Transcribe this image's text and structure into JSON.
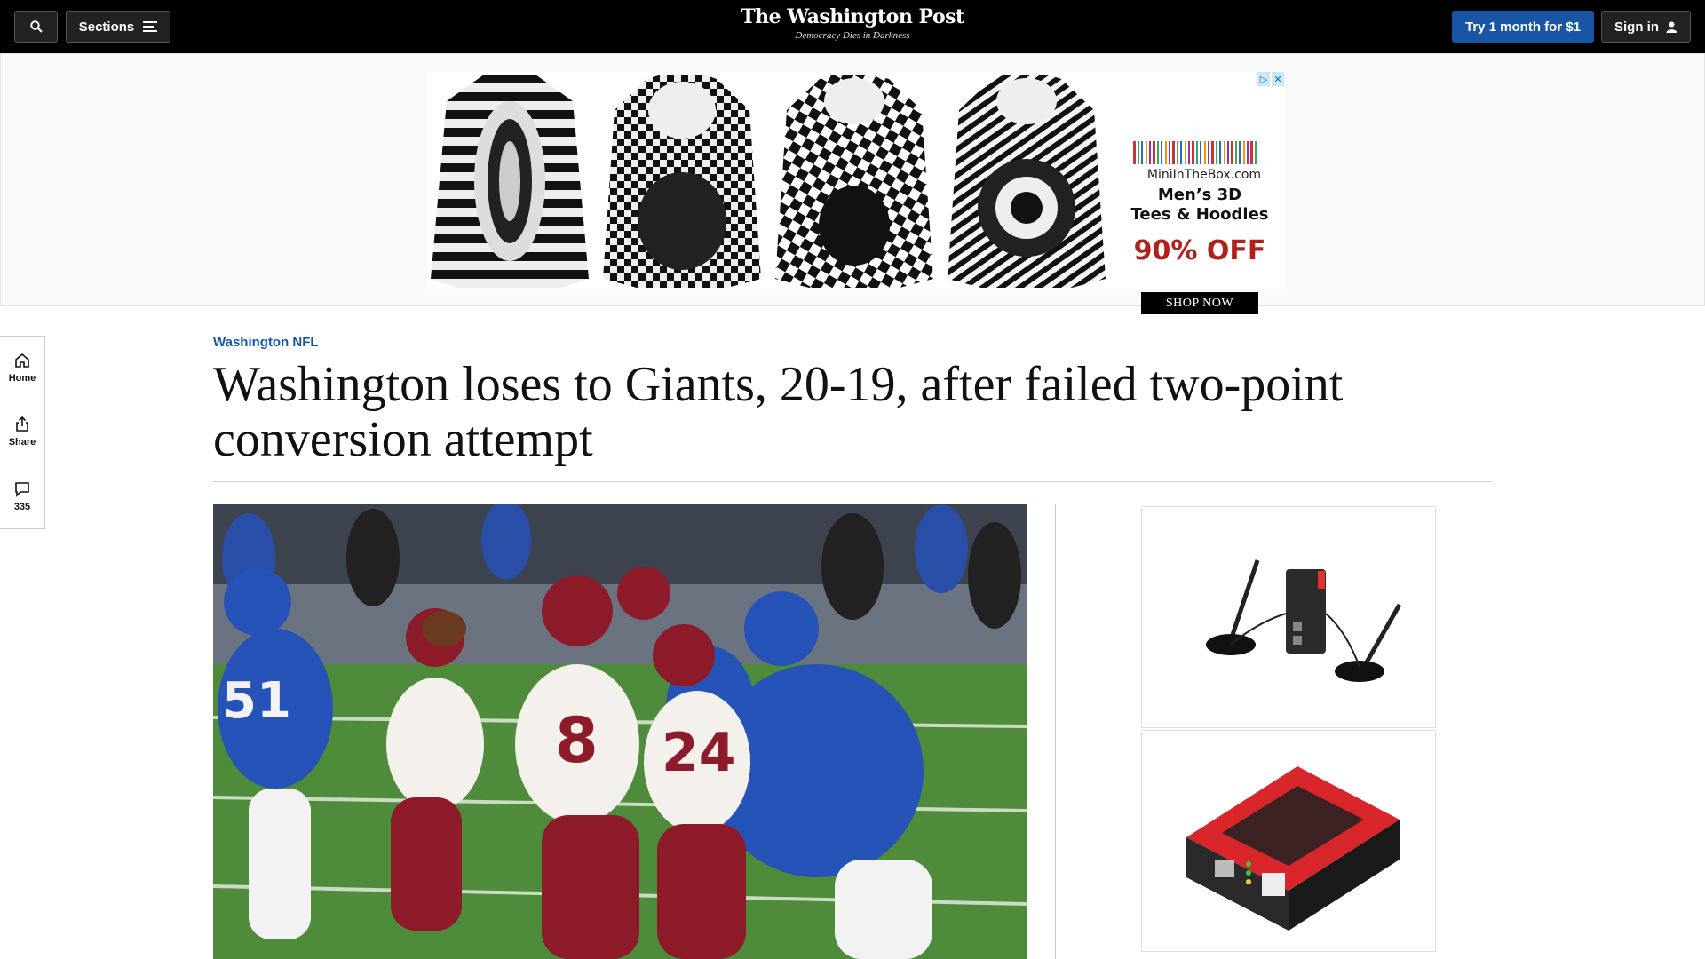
{
  "topbar": {
    "search_icon": "search-icon",
    "sections_label": "Sections",
    "logo": "The Washington Post",
    "tagline": "Democracy Dies in Darkness",
    "subscribe_label": "Try 1 month for $1",
    "signin_label": "Sign in"
  },
  "top_ad": {
    "brand": "MiniInTheBox.com",
    "headline_line1": "Men’s 3D",
    "headline_line2": "Tees & Hoodies",
    "discount": "90% OFF",
    "cta": "SHOP NOW"
  },
  "rail": {
    "home_label": "Home",
    "share_label": "Share",
    "comments_count": "335"
  },
  "article": {
    "kicker": "Washington NFL",
    "headline": "Washington loses to Giants, 20-19, after failed two-point conversion attempt"
  },
  "colors": {
    "accent": "#1955a5",
    "topbar": "#000000",
    "ad_red": "#b3201c"
  }
}
